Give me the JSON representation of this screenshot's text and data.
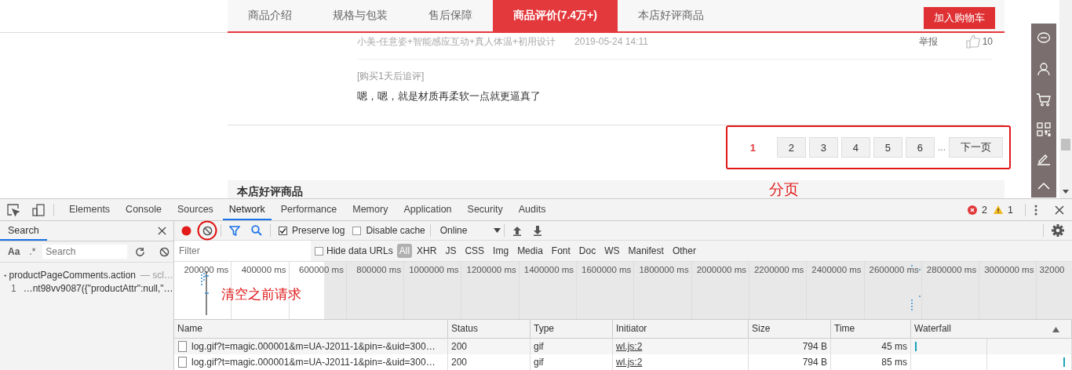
{
  "page": {
    "tabs": [
      {
        "label": "商品介绍",
        "selected": false
      },
      {
        "label": "规格与包装",
        "selected": false
      },
      {
        "label": "售后保障",
        "selected": false
      },
      {
        "label": "商品评价(7.4万+)",
        "selected": true
      },
      {
        "label": "本店好评商品",
        "selected": false
      }
    ],
    "add_to_cart": "加入购物车",
    "comment": {
      "product_attr": "小美-任意姿+智能感应互动+真人体温+初用设计",
      "date": "2019-05-24 14:11",
      "report": "举报",
      "likes": "10",
      "followup_label": "[购买1天后追评]",
      "followup_text": "嗯，嗯，就是材质再柔软一点就更逼真了"
    },
    "pagination": {
      "pages": [
        {
          "label": "1",
          "selected": true
        },
        {
          "label": "2",
          "selected": false
        },
        {
          "label": "3",
          "selected": false
        },
        {
          "label": "4",
          "selected": false
        },
        {
          "label": "5",
          "selected": false
        },
        {
          "label": "6",
          "selected": false
        }
      ],
      "ellipsis": "...",
      "next": "下一页"
    },
    "section_heading": "本店好评商品"
  },
  "annotations": {
    "pagination_label": "分页",
    "clear_label": "清空之前请求"
  },
  "devtools": {
    "tabs": [
      {
        "label": "Elements",
        "selected": false
      },
      {
        "label": "Console",
        "selected": false
      },
      {
        "label": "Sources",
        "selected": false
      },
      {
        "label": "Network",
        "selected": true
      },
      {
        "label": "Performance",
        "selected": false
      },
      {
        "label": "Memory",
        "selected": false
      },
      {
        "label": "Application",
        "selected": false
      },
      {
        "label": "Security",
        "selected": false
      },
      {
        "label": "Audits",
        "selected": false
      }
    ],
    "errors": "2",
    "warnings": "1",
    "search_panel": {
      "title": "Search",
      "match_case": "Aa",
      "regex": ".*",
      "placeholder": "Search",
      "results": [
        {
          "file": "productPageComments.action",
          "path": "— scl…",
          "expanded": true,
          "matches": [
            {
              "line": "1",
              "text": "…nt98vv9087({\"productAttr\":null,\"…"
            }
          ]
        }
      ]
    },
    "toolbar": {
      "recording": true,
      "preserve_log": {
        "label": "Preserve log",
        "checked": true
      },
      "disable_cache": {
        "label": "Disable cache",
        "checked": false
      },
      "throttling": "Online"
    },
    "filter": {
      "placeholder": "Filter",
      "hide_data_urls": {
        "label": "Hide data URLs",
        "checked": false
      },
      "types": [
        {
          "label": "All",
          "selected": true
        },
        {
          "label": "XHR",
          "selected": false
        },
        {
          "label": "JS",
          "selected": false
        },
        {
          "label": "CSS",
          "selected": false
        },
        {
          "label": "Img",
          "selected": false
        },
        {
          "label": "Media",
          "selected": false
        },
        {
          "label": "Font",
          "selected": false
        },
        {
          "label": "Doc",
          "selected": false
        },
        {
          "label": "WS",
          "selected": false
        },
        {
          "label": "Manifest",
          "selected": false
        },
        {
          "label": "Other",
          "selected": false
        }
      ]
    },
    "overview": {
      "ticks": [
        "200000 ms",
        "400000 ms",
        "600000 ms",
        "800000 ms",
        "1000000 ms",
        "1200000 ms",
        "1400000 ms",
        "1600000 ms",
        "1800000 ms",
        "2000000 ms",
        "2200000 ms",
        "2400000 ms",
        "2600000 ms",
        "2800000 ms",
        "3000000 ms",
        "32000"
      ]
    },
    "table": {
      "columns": [
        "Name",
        "Status",
        "Type",
        "Initiator",
        "Size",
        "Time",
        "Waterfall"
      ],
      "rows": [
        {
          "name": "log.gif?t=magic.000001&m=UA-J2011-1&pin=-&uid=300…",
          "status": "200",
          "type": "gif",
          "initiator": "wl.js:2",
          "size": "794 B",
          "time": "45 ms"
        },
        {
          "name": "log.gif?t=magic.000001&m=UA-J2011-1&pin=-&uid=300…",
          "status": "200",
          "type": "gif",
          "initiator": "wl.js:2",
          "size": "794 B",
          "time": "85 ms"
        }
      ]
    }
  }
}
